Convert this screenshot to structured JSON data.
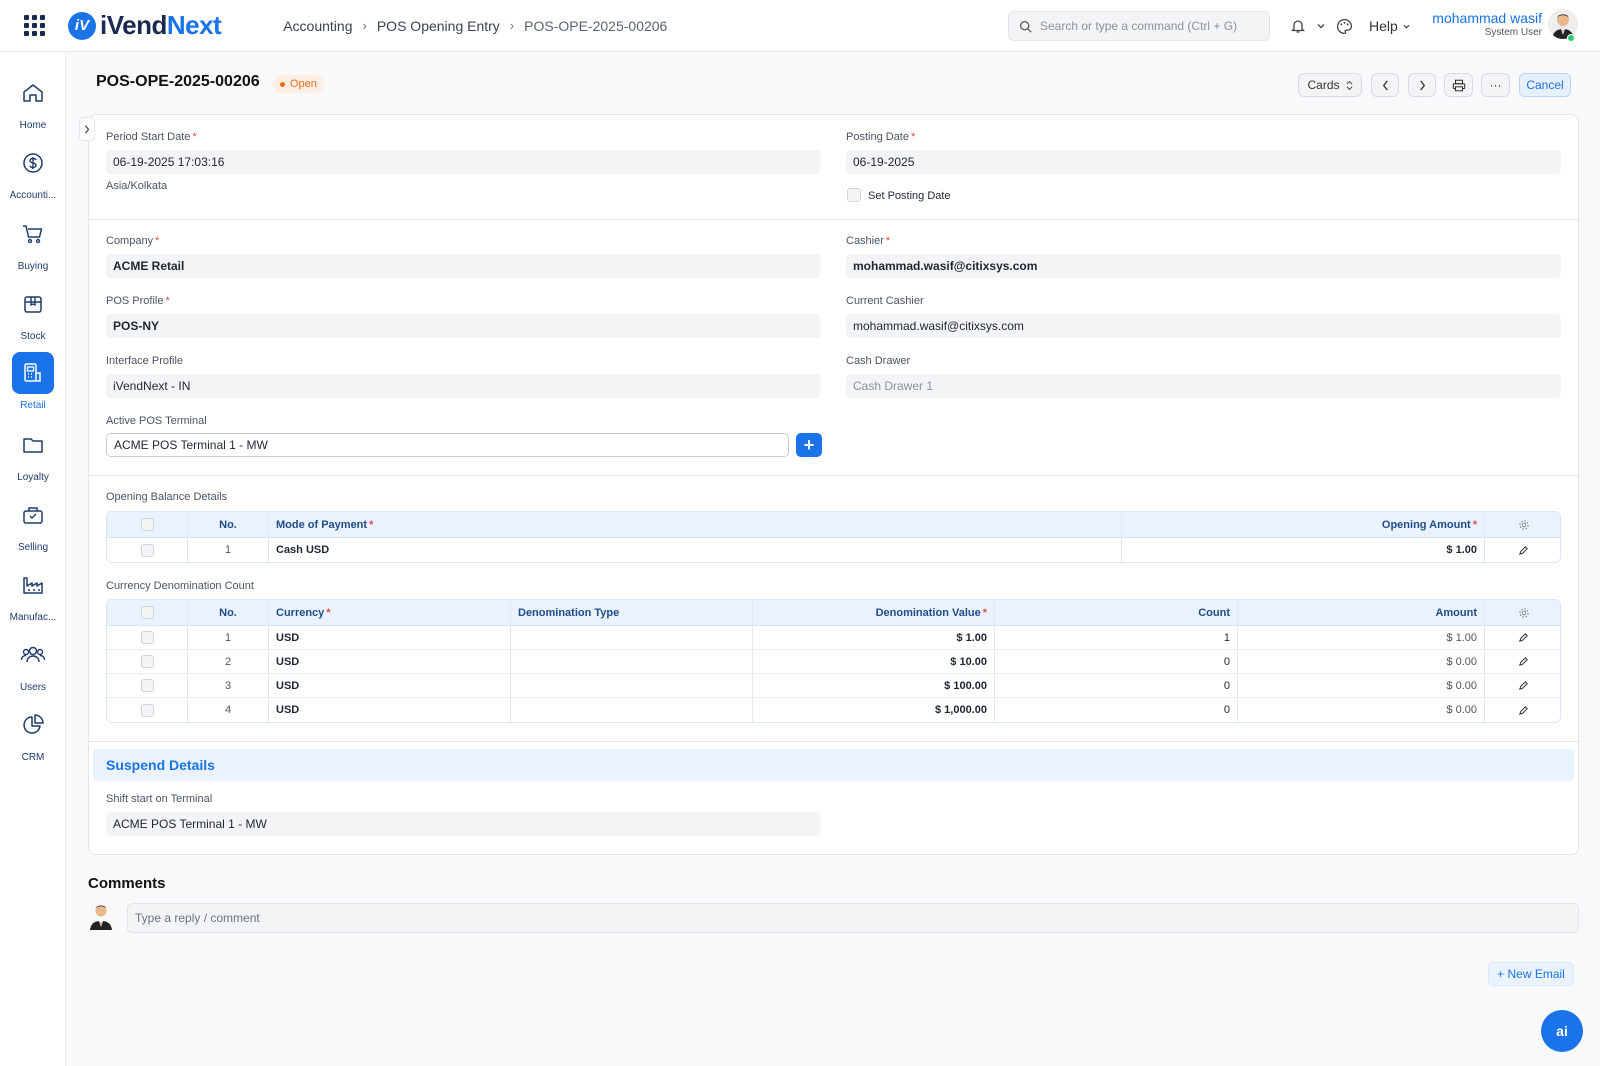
{
  "brand": {
    "name_part1": "iVend",
    "name_part2": "Next"
  },
  "breadcrumb": [
    "Accounting",
    "POS Opening Entry",
    "POS-OPE-2025-00206"
  ],
  "search": {
    "placeholder": "Search or type a command (Ctrl + G)"
  },
  "navbar": {
    "help_label": "Help",
    "user_name": "mohammad wasif",
    "user_role": "System User"
  },
  "sidebar": {
    "items": [
      {
        "label": "Home",
        "icon": "home-icon"
      },
      {
        "label": "Accounti...",
        "icon": "dollar-icon"
      },
      {
        "label": "Buying",
        "icon": "cart-icon"
      },
      {
        "label": "Stock",
        "icon": "box-icon"
      },
      {
        "label": "Retail",
        "icon": "pos-icon",
        "active": true
      },
      {
        "label": "Loyalty",
        "icon": "folder-icon"
      },
      {
        "label": "Selling",
        "icon": "bag-icon"
      },
      {
        "label": "Manufac...",
        "icon": "factory-icon"
      },
      {
        "label": "Users",
        "icon": "users-icon"
      },
      {
        "label": "CRM",
        "icon": "pie-icon"
      }
    ]
  },
  "page": {
    "title": "POS-OPE-2025-00206",
    "status": "Open",
    "cards_label": "Cards",
    "more_label": "···",
    "cancel_label": "Cancel"
  },
  "form": {
    "period_start_date": {
      "label": "Period Start Date",
      "value": "06-19-2025 17:03:16",
      "timezone": "Asia/Kolkata"
    },
    "posting_date": {
      "label": "Posting Date",
      "value": "06-19-2025"
    },
    "set_posting_date": {
      "label": "Set Posting Date",
      "checked": false
    },
    "company": {
      "label": "Company",
      "value": "ACME Retail"
    },
    "cashier": {
      "label": "Cashier",
      "value": "mohammad.wasif@citixsys.com"
    },
    "pos_profile": {
      "label": "POS Profile",
      "value": "POS-NY"
    },
    "current_cashier": {
      "label": "Current Cashier",
      "value": "mohammad.wasif@citixsys.com"
    },
    "interface_profile": {
      "label": "Interface Profile",
      "value": "iVendNext - IN"
    },
    "cash_drawer": {
      "label": "Cash Drawer",
      "value": "Cash Drawer 1"
    },
    "active_pos_terminal": {
      "label": "Active POS Terminal",
      "value": "ACME POS Terminal 1 - MW"
    }
  },
  "opening_balance": {
    "title": "Opening Balance Details",
    "headers": {
      "no": "No.",
      "mode": "Mode of Payment",
      "amount": "Opening Amount"
    },
    "rows": [
      {
        "no": "1",
        "mode": "Cash USD",
        "amount": "$ 1.00"
      }
    ]
  },
  "denomination": {
    "title": "Currency Denomination Count",
    "headers": {
      "no": "No.",
      "currency": "Currency",
      "type": "Denomination Type",
      "value": "Denomination Value",
      "count": "Count",
      "amount": "Amount"
    },
    "rows": [
      {
        "no": "1",
        "currency": "USD",
        "type": "",
        "value": "$ 1.00",
        "count": "1",
        "amount": "$ 1.00"
      },
      {
        "no": "2",
        "currency": "USD",
        "type": "",
        "value": "$ 10.00",
        "count": "0",
        "amount": "$ 0.00"
      },
      {
        "no": "3",
        "currency": "USD",
        "type": "",
        "value": "$ 100.00",
        "count": "0",
        "amount": "$ 0.00"
      },
      {
        "no": "4",
        "currency": "USD",
        "type": "",
        "value": "$ 1,000.00",
        "count": "0",
        "amount": "$ 0.00"
      }
    ]
  },
  "suspend": {
    "title": "Suspend Details",
    "shift_start": {
      "label": "Shift start on Terminal",
      "value": "ACME POS Terminal 1 - MW"
    }
  },
  "comments": {
    "title": "Comments",
    "placeholder": "Type a reply / comment"
  },
  "new_email_label": "+ New Email",
  "ai_label": "ai",
  "colors": {
    "accent": "#1a73e8",
    "status_open": "#e8701a",
    "required": "#e24c4c"
  }
}
